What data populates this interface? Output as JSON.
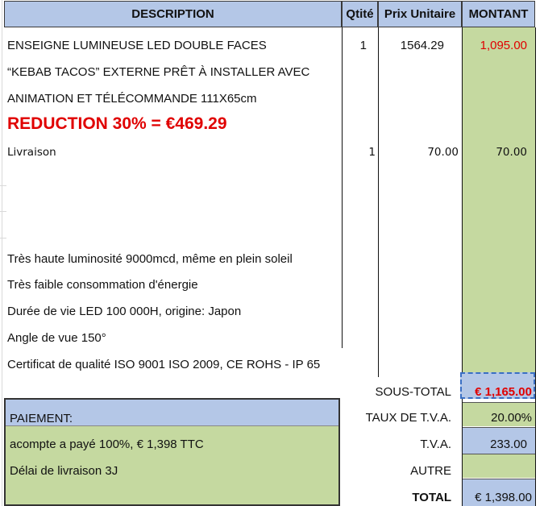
{
  "header": {
    "description": "DESCRIPTION",
    "qty": "Qtité",
    "unit_price": "Prix Unitaire",
    "amount": "MONTANT"
  },
  "items": [
    {
      "lines": [
        "ENSEIGNE LUMINEUSE LED DOUBLE FACES",
        "“KEBAB TACOS” EXTERNE PRÊT À INSTALLER AVEC",
        "ANIMATION ET TÉLÉCOMMANDE 111X65cm"
      ],
      "qty": "1",
      "unit_price": "1564.29",
      "amount": "1,095.00"
    },
    {
      "lines": [
        "Livraison"
      ],
      "qty": "1",
      "unit_price": "70.00",
      "amount": "70.00"
    }
  ],
  "reduction": "REDUCTION 30% = €469.29",
  "features": [
    "Très haute luminosité 9000mcd, même en plein soleil",
    "Très faible consommation d'énergie",
    "Durée de vie LED 100 000H, origine: Japon",
    "Angle de vue 150°",
    "Certificat de qualité ISO 9001 ISO 2009, CE ROHS - IP 65"
  ],
  "payment": {
    "title": "PAIEMENT:",
    "deposit": "acompte a payé 100%, € 1,398  TTC",
    "delivery": "Délai de livraison 3J"
  },
  "totals": {
    "subtotal_label": "SOUS-TOTAL",
    "subtotal_value": "€ 1,165.00",
    "vat_rate_label": "TAUX DE T.V.A.",
    "vat_rate_value": "20.00%",
    "vat_label": "T.V.A.",
    "vat_value": "233.00",
    "other_label": "AUTRE",
    "other_value": "",
    "total_label": "TOTAL",
    "total_value": "€ 1,398.00"
  },
  "colors": {
    "header_blue": "#b4c7e7",
    "amount_green": "#c5d9a0",
    "accent_red": "#e00000"
  }
}
